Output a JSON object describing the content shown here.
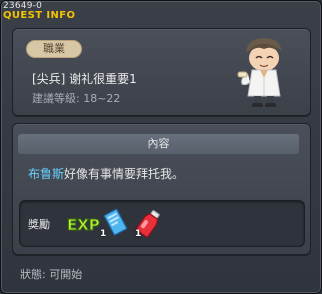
{
  "header": {
    "id_text": "23649-0",
    "title": "QUEST INFO"
  },
  "quest": {
    "category_tag": "職業",
    "name": "[尖兵] 谢礼很重要1",
    "level_text": "建議等級: 18~22"
  },
  "content": {
    "section_title": "內容",
    "npc_name": "布鲁斯",
    "description_rest": "好像有事情要拜托我。"
  },
  "reward": {
    "label": "獎勵",
    "exp_icon_text": "EXP",
    "items": [
      {
        "icon": "blue-scroll-icon",
        "count": "1"
      },
      {
        "icon": "red-potion-icon",
        "count": "1"
      }
    ]
  },
  "status": {
    "text": "狀態: 可開始"
  },
  "colors": {
    "title": "#f2c400",
    "npc_name": "#6ad0ff",
    "tag_bg": "#d8c7a5"
  }
}
